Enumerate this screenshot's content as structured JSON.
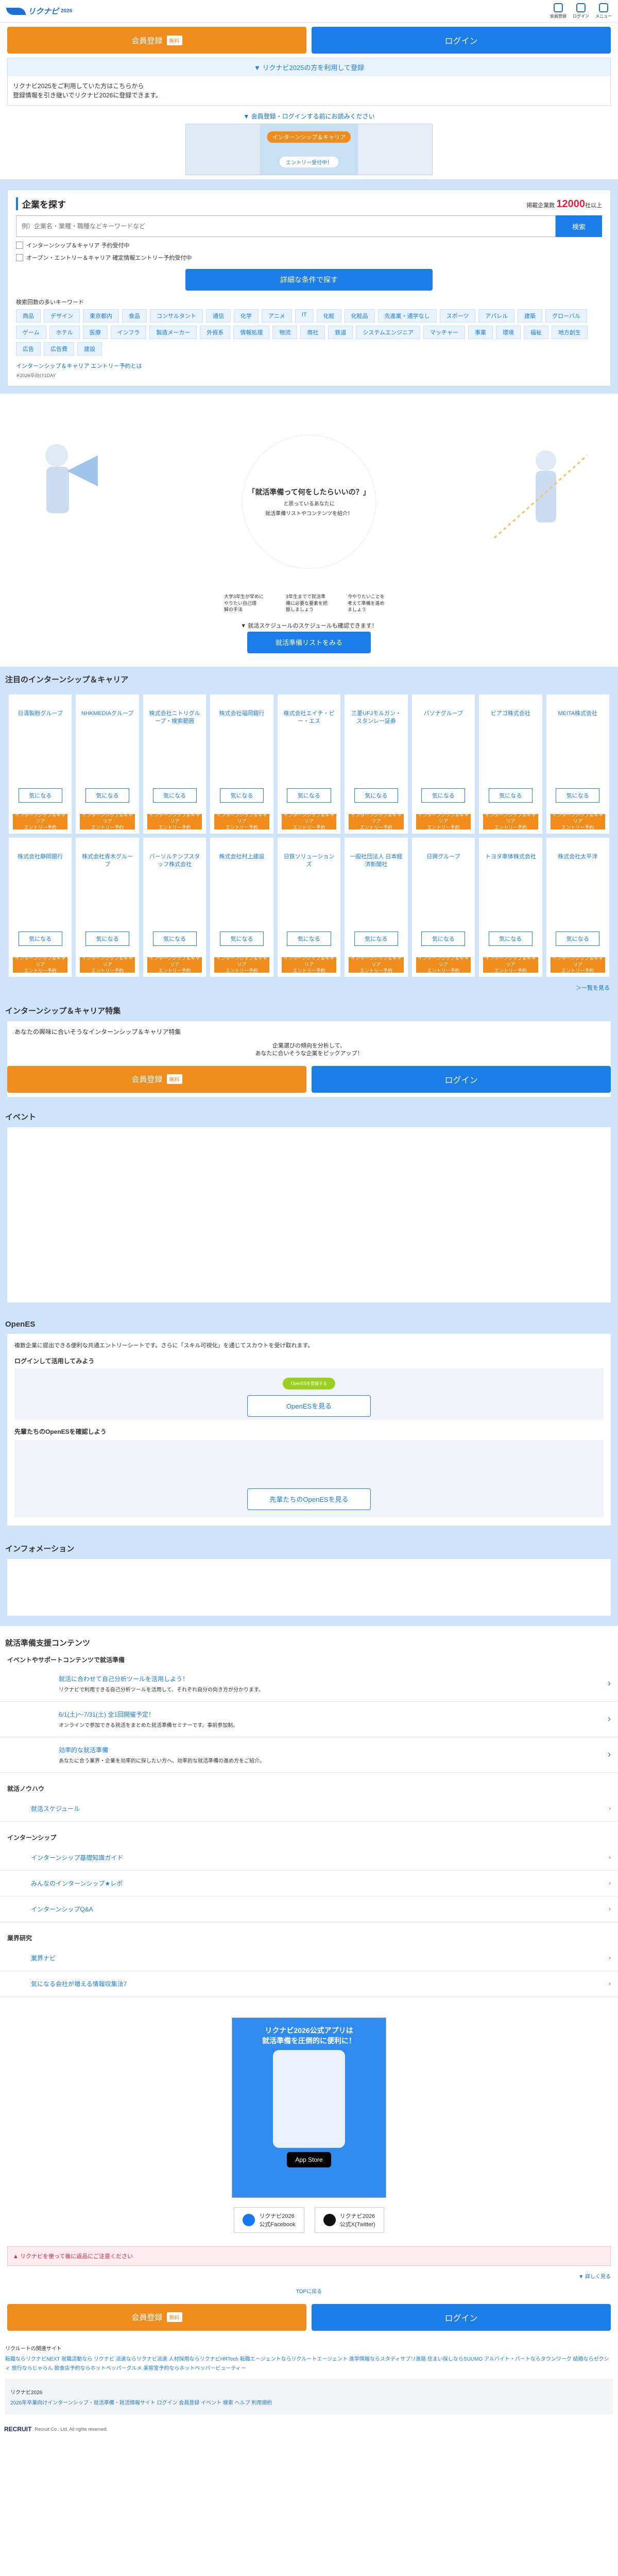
{
  "header": {
    "logo_text": "リクナビ",
    "logo_year": "2026",
    "icons": [
      {
        "name": "user-icon",
        "label": "会員登録"
      },
      {
        "name": "login-icon",
        "label": "ログイン"
      },
      {
        "name": "menu-icon",
        "label": "メニュー"
      }
    ]
  },
  "auth": {
    "register_label": "会員登録",
    "register_badge": "無料",
    "login_label": "ログイン"
  },
  "notice": {
    "title": "▼ リクナビ2025の方を利用して登録",
    "body": "リクナビ2025をご利用していた方はこちらから\n登録情報を引き継いでリクナビ2026に登録できます。"
  },
  "link_center": "▼ 会員登録・ログインする前にお読みください",
  "banner": {
    "tag": "インターンシップ＆キャリア",
    "btn": "エントリー受付中！"
  },
  "search": {
    "title": "企業を探す",
    "count_label": "掲載企業数",
    "count_value": "12000",
    "count_suffix": "社以上",
    "placeholder": "例）企業名・業種・職種などキーワードなど",
    "button": "検索",
    "checks": [
      "インターンシップ＆キャリア 予約受付中",
      "オープン・エントリー＆キャリア 確定情報エントリー予約受付中"
    ],
    "detail_button": "詳細な条件で探す",
    "kw_title": "検索回数の多いキーワード",
    "keywords": [
      "商品",
      "デザイン",
      "東京都内",
      "食品",
      "コンサルタント",
      "通信",
      "化学",
      "アニメ",
      "IT",
      "化粧",
      "化粧品",
      "先進業・通学なし",
      "スポーツ",
      "アパレル",
      "建築",
      "グローバル",
      "ゲーム",
      "ホテル",
      "医療",
      "インフラ",
      "製造メーカー",
      "外資系",
      "情報処理",
      "物流",
      "商社",
      "鉄道",
      "システムエンジニア",
      "マッチャー",
      "事業",
      "環境",
      "福祉",
      "地方創生",
      "広告",
      "広告費",
      "建設"
    ],
    "link": "インターンシップ＆キャリア エントリー予約とは",
    "small": "※2026卒向け1DAY"
  },
  "hero": {
    "question": "「就活準備って何をしたらいいの？」",
    "sub1": "と思っているあなたに",
    "sub2": "就活準備リストやコンテンツを紹介！",
    "col1": "大学3年生が早めに\nやりたい自己理\n解の手法",
    "col2": "3年生までで就活準\n備に必要な要素を把\n握しましょう",
    "col3": "今やりたいことを\n考えて準備を進め\nましょう",
    "sched_text": "▼ 就活スケジュールのスケジュールも確認できます！",
    "sched_btn": "就活準備リストをみる"
  },
  "notable": {
    "title": "注目のインターンシップ＆キャリア",
    "fav": "気になる",
    "entry": "インターンシップ＆キャリア\nエントリー予約",
    "companies": [
      "日清製粉グループ",
      "NHKMEDIAグループ",
      "株式会社ニトリグループ・検索範囲",
      "株式会社福岡銀行",
      "株式会社エイチ・ピー・エス",
      "三菱UFJモルガン・スタンレー証券",
      "パソナグループ",
      "ビアゴ株式会社",
      "MEITA株式会社",
      "株式会社静岡銀行",
      "株式会社青木グループ",
      "パーソルテンプスタッフ株式会社",
      "株式会社村上建設",
      "日鉄ソリューションズ",
      "一般社団法人 日本経済新聞社",
      "日興グループ",
      "トヨタ車体株式会社",
      "株式会社太平洋"
    ],
    "more": "＞一覧を見る"
  },
  "feature": {
    "title": "インターンシップ＆キャリア特集",
    "sub": "あなたの興味に合いそうなインターンシップ＆キャリア特集",
    "msg1": "企業選びの傾向を分析して、",
    "msg2": "あなたに合いそうな企業をピックアップ！"
  },
  "event": {
    "title": "イベント"
  },
  "openes": {
    "title": "OpenES",
    "desc": "複数企業に提出できる便利な共通エントリーシートです。さらに「スキル可視化」を通じてスカウトを受け取れます。",
    "h1": "ログインして活用してみよう",
    "pill": "OpenESを登録する",
    "btn1": "OpenESを見る",
    "h2": "先輩たちのOpenESを確認しよう",
    "btn2": "先輩たちのOpenESを見る"
  },
  "info": {
    "title": "インフォメーション"
  },
  "prep": {
    "title": "就活準備支援コンテンツ",
    "sub": "イベントやサポートコンテンツで就活準備",
    "items": [
      {
        "t1": "就活に合わせて自己分析ツールを活用しよう！",
        "t2": "リクナビで利用できる自己分析ツールを活用して、それぞれ自分の向き方が分かります。"
      },
      {
        "t1": "6/1(土)～7/31(土) 全1回開催予定！",
        "t2": "オンラインで参加できる就活をまとめた就活準備セミナーです。事前参加制。"
      },
      {
        "t1": "効率的な就活準備",
        "t2": "あなたに合う業界・企業を効率的に探したい方へ、効率的な就活準備の進め方をご紹介。"
      }
    ]
  },
  "knowhow": {
    "groups": [
      {
        "head": "就活ノウハウ",
        "items": [
          "就活スケジュール"
        ]
      },
      {
        "head": "インターンシップ",
        "items": [
          "インターンシップ基礎知識ガイド",
          "みんなのインターンシップ★レポ",
          "インターンシップQ&A"
        ]
      },
      {
        "head": "業界研究",
        "items": [
          "業界ナビ",
          "気になる会社が増える情報収集法7"
        ]
      }
    ]
  },
  "app": {
    "title": "リクナビ2026公式アプリは\n就活準備を圧倒的に便利に！",
    "store": "App Store"
  },
  "social": [
    {
      "icon": "facebook-icon",
      "label": "リクナビ2026\n公式Facebook"
    },
    {
      "icon": "x-icon",
      "label": "リクナビ2026\n公式X(Twitter)"
    }
  ],
  "alert": "▲ リクナビを使って後に返品にご注意ください",
  "right_link": "▼ 詳しく見る",
  "pagetop": "TOPに戻る",
  "footer": {
    "label1": "リクルートの関連サイト",
    "links": "転職ならリクナビNEXT 就職活動なら リクナビ 派遣ならリクナビ派遣 人材採用ならリクナビHRTech 転職エージェントならリクルートエージェント 進学情報ならスタディサプリ進路 住まい探しならSUUMO アルバイト・パートならタウンワーク 結婚ならゼクシィ 旅行ならじゃらん 飲食店予約ならホットペッパーグルメ 美容室予約ならホットペッパービューティー",
    "label2": "リクナビ2026",
    "links2": "2026年卒業向けインターンシップ・就活準備・就活情報サイト ログイン 会員登録 イベント 検索 ヘルプ 利用規約",
    "copyright": "Recruit Co., Ltd. All rights reserved."
  },
  "colors": {
    "accent": "#1b7ee8",
    "orange": "#f08c1c",
    "light_blue": "#cfe3fb",
    "red": "#e2233b"
  }
}
